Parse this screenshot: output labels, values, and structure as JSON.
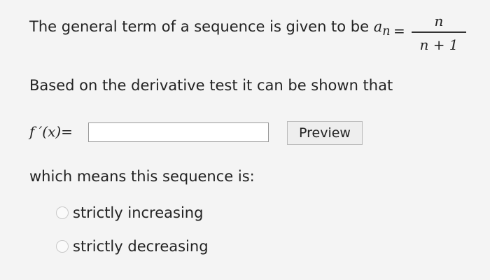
{
  "question": {
    "line1": "The general term of a sequence is given to be",
    "term_symbol": "a",
    "term_subscript": "n",
    "equals": "=",
    "fraction_numerator": "n",
    "fraction_denominator": "n + 1",
    "line2": "Based on the derivative test it can be shown that",
    "fx_label": "f ′(x)=",
    "line3": "which means this sequence is:"
  },
  "answer_field": {
    "value": "",
    "placeholder": ""
  },
  "preview_button": {
    "label": "Preview"
  },
  "options": [
    {
      "label": "strictly increasing",
      "selected": false
    },
    {
      "label": "strictly decreasing",
      "selected": false
    }
  ]
}
